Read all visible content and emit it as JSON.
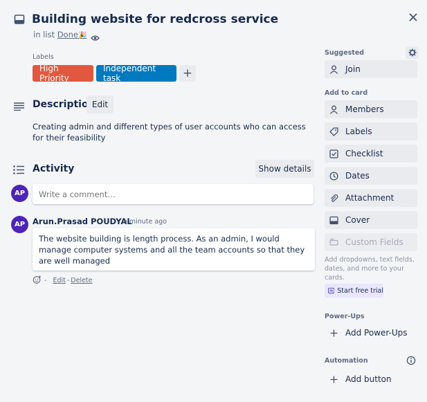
{
  "card": {
    "title": "Building website for redcross service",
    "in_list_prefix": "in list",
    "list_name": "Done",
    "list_emoji": "🎉"
  },
  "labels": {
    "heading": "Labels",
    "items": [
      {
        "text": "High Priority",
        "color": "#e2583e"
      },
      {
        "text": "Independent task",
        "color": "#0079bf"
      }
    ],
    "add_symbol": "+"
  },
  "description": {
    "title": "Description",
    "edit_label": "Edit",
    "text": "Creating admin and different types of user accounts who can access for their feasibility"
  },
  "activity": {
    "title": "Activity",
    "show_details_label": "Show details",
    "comment_placeholder": "Write a comment…",
    "avatar_initials": "AP",
    "comment": {
      "author": "Arun.Prasad POUDYAL",
      "time": "a minute ago",
      "text": "The website building is length process. As an admin, I would manage computer systems and all the team accounts so that they are well managed",
      "dash": "-",
      "edit_label": "Edit",
      "sep": "-",
      "delete_label": "Delete"
    }
  },
  "sidebar": {
    "suggested_heading": "Suggested",
    "join_label": "Join",
    "add_to_card_heading": "Add to card",
    "items": [
      {
        "label": "Members",
        "icon": "person-icon"
      },
      {
        "label": "Labels",
        "icon": "tag-icon"
      },
      {
        "label": "Checklist",
        "icon": "checkbox-icon"
      },
      {
        "label": "Dates",
        "icon": "clock-icon"
      },
      {
        "label": "Attachment",
        "icon": "paperclip-icon"
      },
      {
        "label": "Cover",
        "icon": "cover-icon"
      }
    ],
    "custom_fields_label": "Custom Fields",
    "custom_fields_note": "Add dropdowns, text fields, dates, and more to your cards.",
    "trial_label": "Start free trial",
    "powerups_heading": "Power-Ups",
    "add_powerups_label": "Add Power-Ups",
    "automation_heading": "Automation",
    "add_button_label": "Add button"
  },
  "colors": {
    "background": "#f4f5f7",
    "avatar": "#4c24b8",
    "trial_bg": "#eae6ff"
  }
}
